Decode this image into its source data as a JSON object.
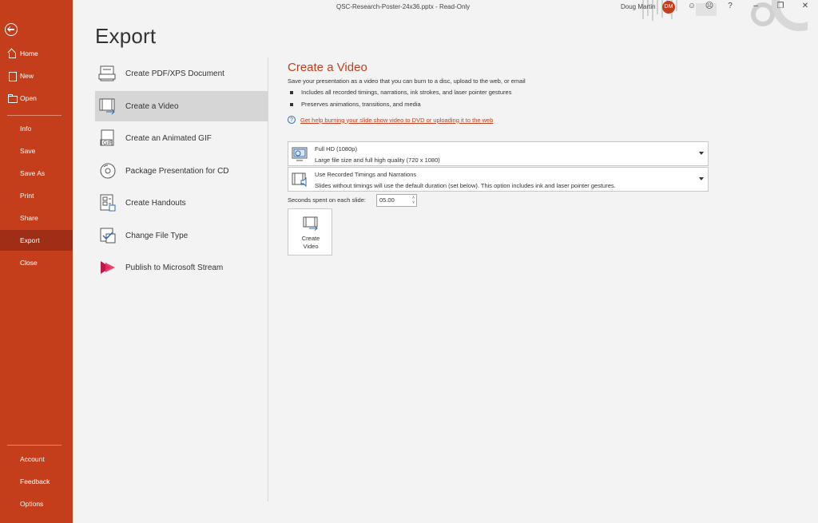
{
  "titlebar": {
    "doc_title": "QSC-Research-Poster-24x36.pptx  -  Read-Only",
    "user_name": "Doug Martin",
    "avatar_initials": "DM",
    "help": "?",
    "minimize": "–",
    "restore": "❐",
    "close": "✕"
  },
  "nav": {
    "items": [
      {
        "label": "Home",
        "icon": "home-icon"
      },
      {
        "label": "New",
        "icon": "new-icon"
      },
      {
        "label": "Open",
        "icon": "open-folder-icon"
      },
      {
        "label": "Info"
      },
      {
        "label": "Save"
      },
      {
        "label": "Save As"
      },
      {
        "label": "Print"
      },
      {
        "label": "Share"
      },
      {
        "label": "Export"
      },
      {
        "label": "Close"
      }
    ],
    "bottom": [
      {
        "label": "Account"
      },
      {
        "label": "Feedback"
      },
      {
        "label": "Options"
      }
    ],
    "active": "Export",
    "accent": "#c43e1c"
  },
  "page": {
    "title": "Export"
  },
  "options": [
    {
      "label": "Create PDF/XPS Document",
      "icon": "pdf-document-icon"
    },
    {
      "label": "Create a Video",
      "icon": "video-icon"
    },
    {
      "label": "Create an Animated GIF",
      "icon": "gif-icon"
    },
    {
      "label": "Package Presentation for CD",
      "icon": "cd-icon"
    },
    {
      "label": "Create Handouts",
      "icon": "handouts-icon"
    },
    {
      "label": "Change File Type",
      "icon": "change-file-type-icon"
    },
    {
      "label": "Publish to Microsoft Stream",
      "icon": "stream-icon"
    }
  ],
  "selected_option": "Create a Video",
  "panel": {
    "title": "Create a Video",
    "description": "Save your presentation as a video that you can burn to a disc, upload to the web, or email",
    "bullets": [
      "Includes all recorded timings, narrations, ink strokes, and laser pointer gestures",
      "Preserves animations, transitions, and media"
    ],
    "help_link": "Get help burning your slide show video to DVD or uploading it to the web",
    "quality": {
      "title": "Full HD (1080p)",
      "subtitle": "Large file size and full high quality (720 x 1080)"
    },
    "timings": {
      "title": "Use Recorded Timings and Narrations",
      "subtitle": "Slides without timings will use the default duration (set below). This option includes ink and laser pointer gestures."
    },
    "seconds_label": "Seconds spent on each slide:",
    "seconds_value": "05.00",
    "create_button_line1": "Create",
    "create_button_line2": "Video"
  }
}
